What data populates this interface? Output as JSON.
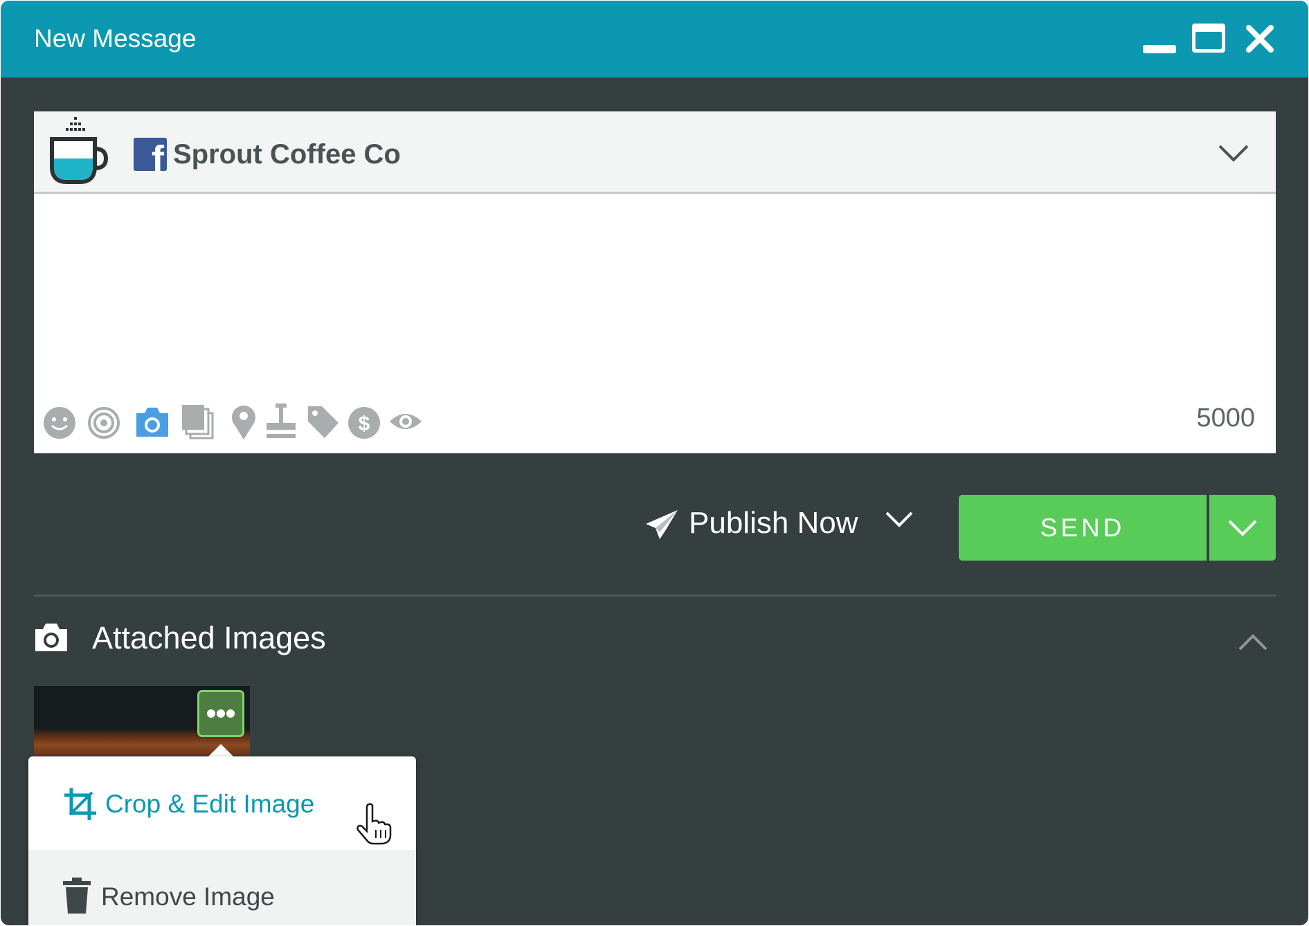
{
  "window": {
    "title": "New Message",
    "controls": [
      "minimize-icon",
      "maximize-icon",
      "close-icon"
    ]
  },
  "profile": {
    "network": "facebook",
    "name": "Sprout Coffee Co"
  },
  "composer": {
    "message": "",
    "char_count": "5000",
    "tools": [
      "emoji-icon",
      "target-icon",
      "camera-icon",
      "gallery-icon",
      "location-icon",
      "stamp-icon",
      "tag-icon",
      "dollar-icon",
      "eye-icon"
    ]
  },
  "publish": {
    "mode_label": "Publish Now",
    "send_label": "SEND"
  },
  "attachments": {
    "title": "Attached Images"
  },
  "image_menu": {
    "crop_label": "Crop & Edit Image",
    "remove_label": "Remove Image"
  },
  "colors": {
    "titlebar": "#0b98b0",
    "background": "#363f40",
    "send": "#59cb59",
    "link": "#0b98b0",
    "active_tool": "#4a9fe4",
    "inactive_tool": "#a9adae"
  }
}
